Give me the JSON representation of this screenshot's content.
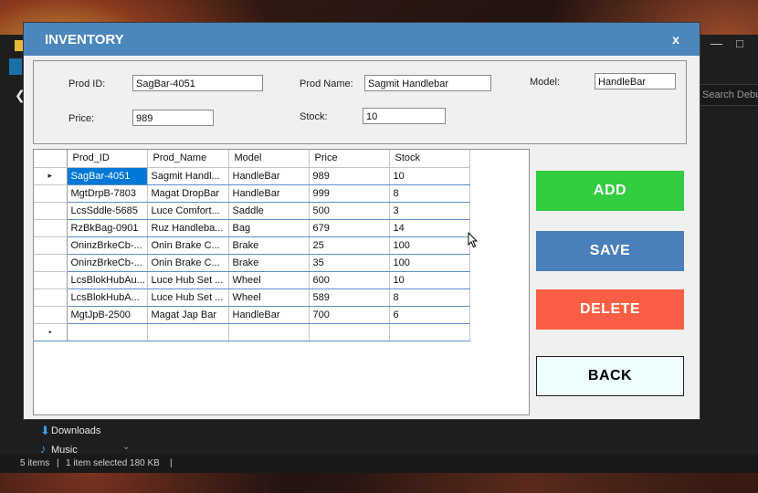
{
  "window": {
    "title": "INVENTORY",
    "close_label": "x"
  },
  "form": {
    "prod_id_label": "Prod ID:",
    "prod_id_value": "SagBar-4051",
    "prod_name_label": "Prod Name:",
    "prod_name_value": "Sagmit Handlebar",
    "model_label": "Model:",
    "model_value": "HandleBar",
    "price_label": "Price:",
    "price_value": "989",
    "stock_label": "Stock:",
    "stock_value": "10"
  },
  "grid": {
    "columns": [
      "Prod_ID",
      "Prod_Name",
      "Model",
      "Price",
      "Stock"
    ],
    "current_row_marker": "▸",
    "new_row_marker": "•",
    "rows": [
      [
        "SagBar-4051",
        "Sagmit Handl...",
        "HandleBar",
        "989",
        "10"
      ],
      [
        "MgtDrpB-7803",
        "Magat DropBar",
        "HandleBar",
        "999",
        "8"
      ],
      [
        "LcsSddle-5685",
        "Luce Comfort...",
        "Saddle",
        "500",
        "3"
      ],
      [
        "RzBkBag-0901",
        "Ruz Handleba...",
        "Bag",
        "679",
        "14"
      ],
      [
        "OninzBrkeCb-...",
        "Onin Brake C...",
        "Brake",
        "25",
        "100"
      ],
      [
        "OninzBrkeCb-...",
        "Onin Brake C...",
        "Brake",
        "35",
        "100"
      ],
      [
        "LcsBlokHubAu...",
        "Luce Hub Set ...",
        "Wheel",
        "600",
        "10"
      ],
      [
        "LcsBlokHubA...",
        "Luce Hub Set ...",
        "Wheel",
        "589",
        "8"
      ],
      [
        "MgtJpB-2500",
        "Magat Jap Bar",
        "HandleBar",
        "700",
        "6"
      ]
    ]
  },
  "buttons": {
    "add": "ADD",
    "save": "SAVE",
    "delete": "DELETE",
    "back": "BACK"
  },
  "background": {
    "search_text": "Search Debug",
    "nav_downloads": "Downloads",
    "nav_music": "Music",
    "status_items": "5 items",
    "status_selected": "1 item selected  180 KB",
    "status_sep": "|"
  },
  "colors": {
    "titlebar": "#4b86bc",
    "add": "#33cc40",
    "save": "#4b7fbb",
    "delete": "#fa5f46",
    "back": "#eefdfd",
    "selection": "#0078d7"
  }
}
